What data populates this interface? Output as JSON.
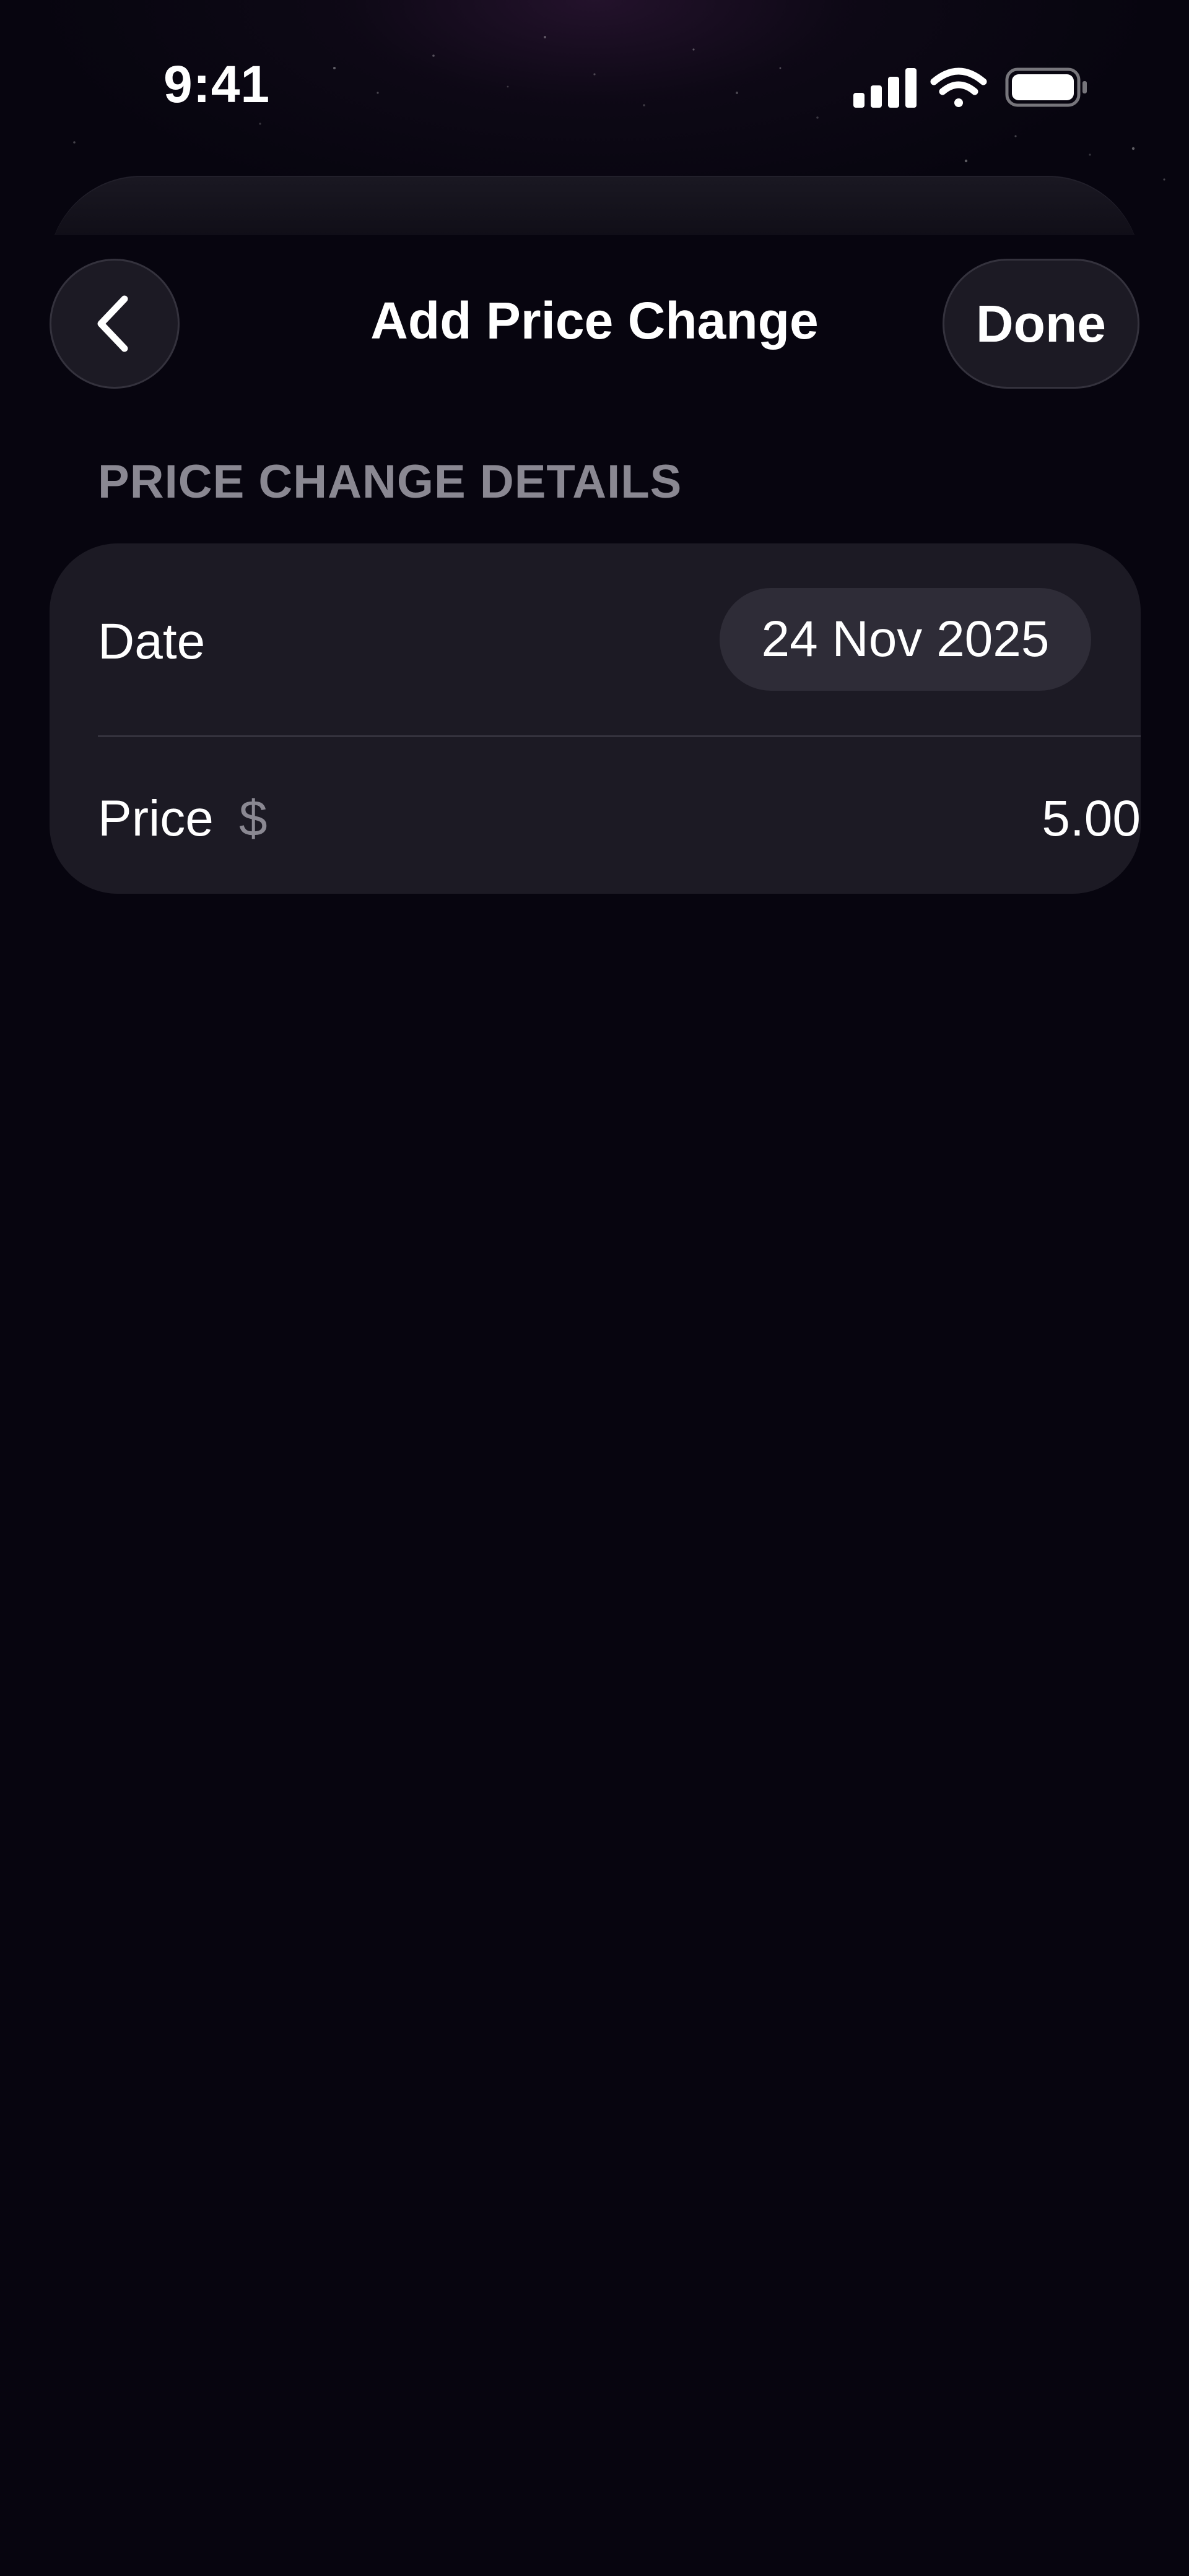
{
  "status_bar": {
    "time": "9:41",
    "icons": [
      "cellular-signal-icon",
      "wifi-icon",
      "battery-icon"
    ]
  },
  "nav": {
    "back_icon": "chevron-left-icon",
    "title": "Add Price Change",
    "done_label": "Done"
  },
  "section": {
    "header": "PRICE CHANGE DETAILS"
  },
  "form": {
    "date": {
      "label": "Date",
      "value": "24 Nov 2025"
    },
    "price": {
      "label": "Price",
      "currency_symbol": "$",
      "value": "5.00"
    }
  },
  "colors": {
    "background": "#07050f",
    "card": "#1c1a24",
    "pill": "#2e2c37",
    "secondary_text": "#8a8892",
    "primary_text": "#ffffff"
  }
}
